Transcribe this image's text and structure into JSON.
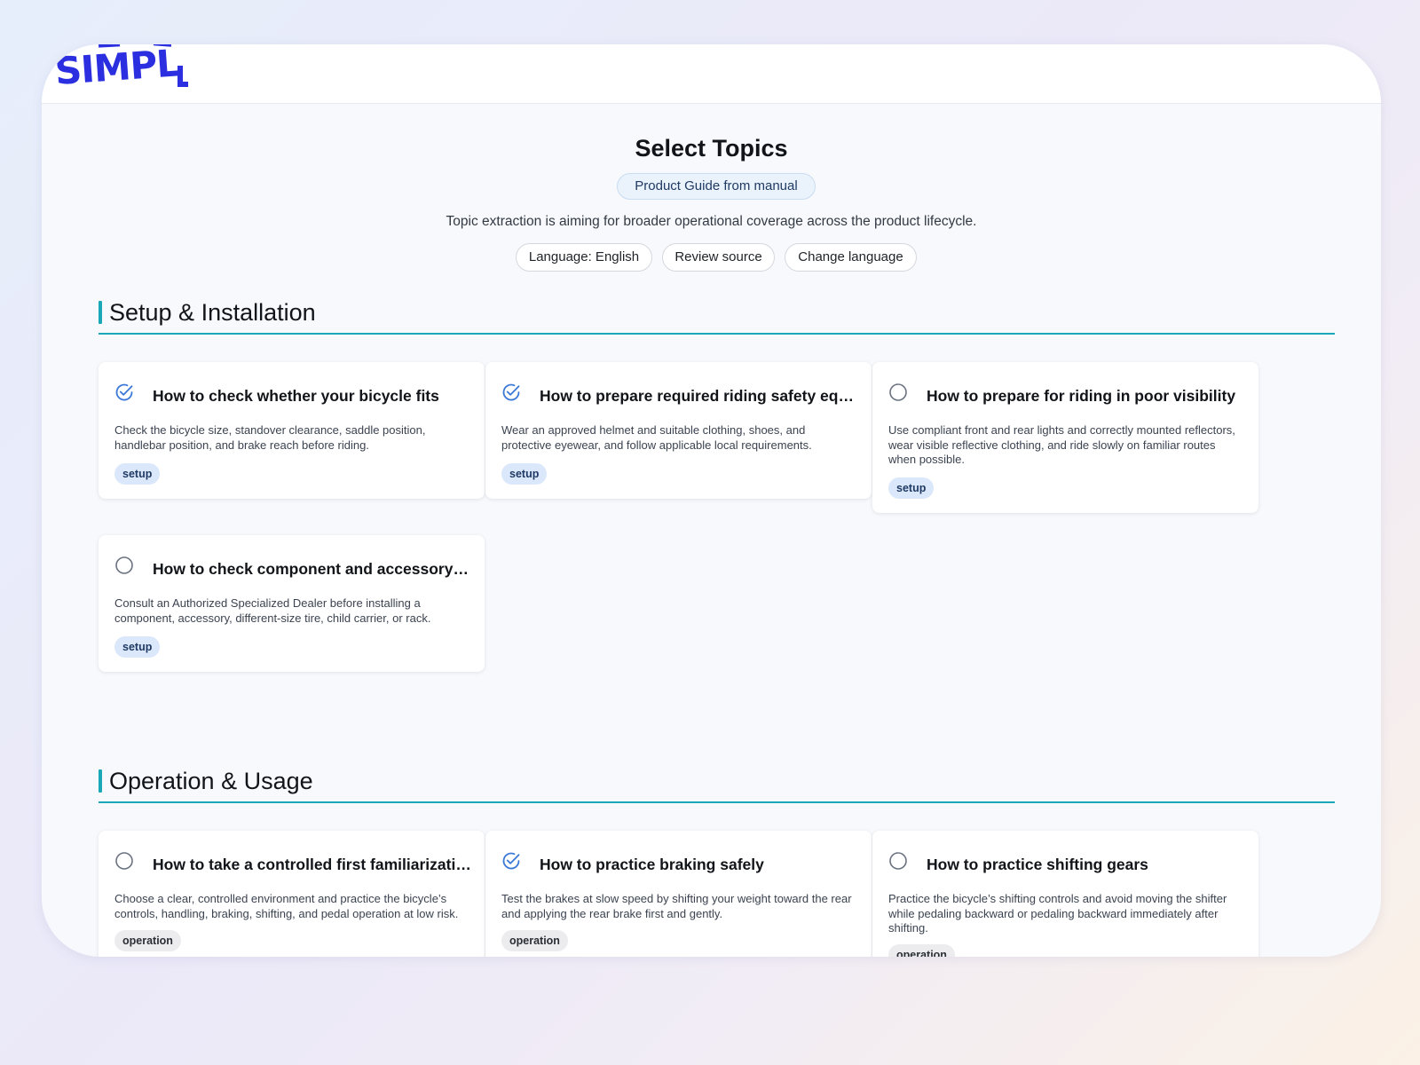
{
  "header": {
    "logo_text": "SIMPL",
    "brand_color": "#2b2fe0"
  },
  "page": {
    "title": "Select Topics",
    "guide_badge": "Product Guide from manual",
    "subtitle": "Topic extraction is aiming for broader operational coverage across the product lifecycle.",
    "language_chip": "Language: English",
    "review_source": "Review source",
    "change_language": "Change language",
    "accent_color": "#1aa7b8"
  },
  "sections": [
    {
      "title": "Setup & Installation",
      "cards": [
        {
          "checked": true,
          "icon": "check-circle-icon",
          "title": "How to check whether your bicycle fits",
          "description": "Check the bicycle size, standover clearance, saddle position, handlebar position, and brake reach before riding.",
          "tag": "setup"
        },
        {
          "checked": true,
          "icon": "check-circle-icon",
          "title": "How to prepare required riding safety equipm…",
          "description": "Wear an approved helmet and suitable clothing, shoes, and protective eyewear, and follow applicable local requirements.",
          "tag": "setup"
        },
        {
          "checked": false,
          "icon": "empty-circle-icon",
          "title": "How to prepare for riding in poor visibility",
          "description": "Use compliant front and rear lights and correctly mounted reflectors, wear visible reflective clothing, and ride slowly on familiar routes when possible.",
          "tag": "setup"
        },
        {
          "checked": false,
          "icon": "empty-circle-icon",
          "title": "How to check component and accessory co…",
          "description": "Consult an Authorized Specialized Dealer before installing a component, accessory, different-size tire, child carrier, or rack.",
          "tag": "setup"
        }
      ]
    },
    {
      "title": "Operation & Usage",
      "cards": [
        {
          "checked": false,
          "icon": "empty-circle-icon",
          "title": "How to take a controlled first familiarization r…",
          "description": "Choose a clear, controlled environment and practice the bicycle’s controls, handling, braking, shifting, and pedal operation at low risk.",
          "tag": "operation"
        },
        {
          "checked": true,
          "icon": "check-circle-icon",
          "title": "How to practice braking safely",
          "description": "Test the brakes at slow speed by shifting your weight toward the rear and applying the rear brake first and gently.",
          "tag": "operation"
        },
        {
          "checked": false,
          "icon": "empty-circle-icon",
          "title": "How to practice shifting gears",
          "description": "Practice the bicycle’s shifting controls and avoid moving the shifter while pedaling backward or pedaling backward immediately after shifting.",
          "tag": "operation"
        }
      ]
    }
  ]
}
